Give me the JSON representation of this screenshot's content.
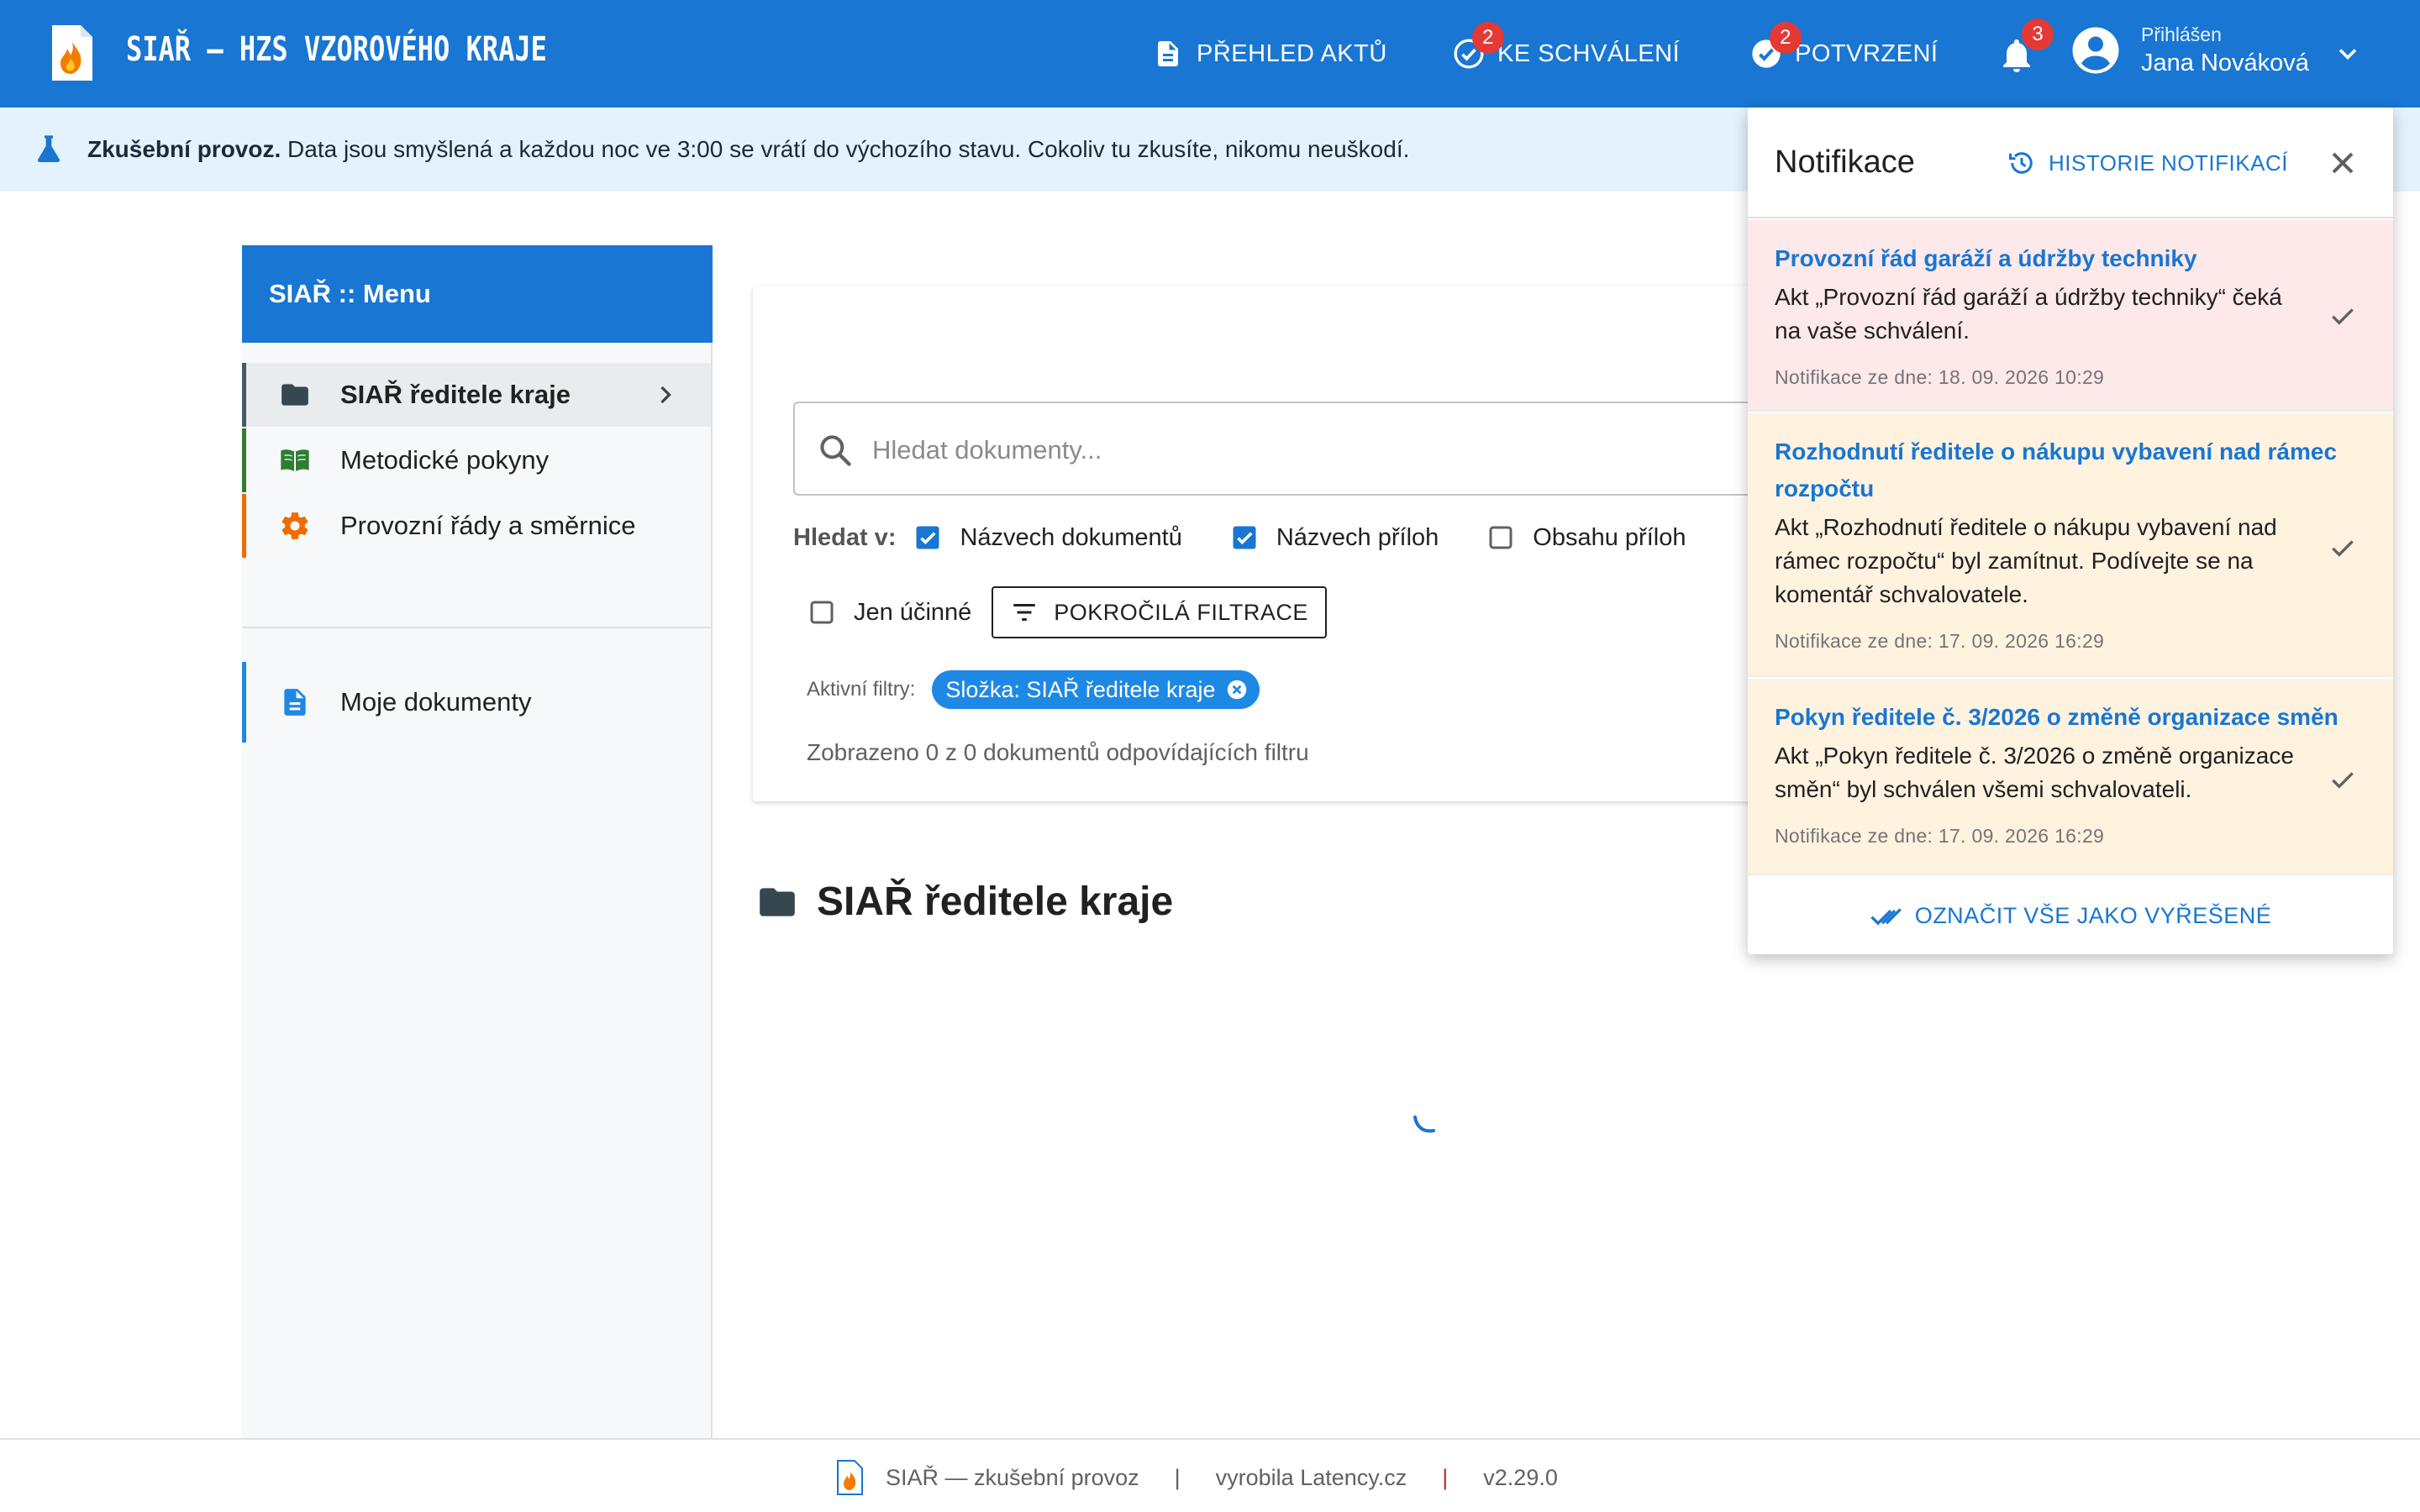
{
  "app": {
    "title": "SIAŘ – HZS VZOROVÉHO KRAJE",
    "brand_color": "#1976d2"
  },
  "nav": {
    "overview": {
      "label": "PŘEHLED AKTŮ"
    },
    "approval": {
      "label": "KE SCHVÁLENÍ",
      "badge": "2"
    },
    "confirm": {
      "label": "POTVRZENÍ",
      "badge": "2"
    },
    "notifications": {
      "badge": "3"
    },
    "user": {
      "label": "Přihlášen",
      "name": "Jana Nováková"
    }
  },
  "banner": {
    "strong": "Zkušební provoz.",
    "text": " Data jsou smyšlená a každou noc ve 3:00 se vrátí do výchozího stavu. Cokoliv tu zkusíte, nikomu neuškodí."
  },
  "sidebar": {
    "header": "SIAŘ :: Menu",
    "items": [
      {
        "label": "SIAŘ ředitele kraje",
        "icon": "folder-icon",
        "accent": "#455a64"
      },
      {
        "label": "Metodické pokyny",
        "icon": "book-icon",
        "accent": "#2e7d32"
      },
      {
        "label": "Provozní řády a směrnice",
        "icon": "gear-icon",
        "accent": "#ef6c00"
      },
      {
        "label": "Moje dokumenty",
        "icon": "document-icon",
        "accent": "#1e88e5"
      }
    ]
  },
  "search": {
    "placeholder": "Hledat dokumenty...",
    "value": "",
    "search_in_label": "Hledat v:",
    "options": [
      {
        "label": "Názvech dokumentů",
        "checked": true
      },
      {
        "label": "Názvech příloh",
        "checked": true
      },
      {
        "label": "Obsahu příloh",
        "checked": false
      }
    ],
    "effective_only": {
      "label": "Jen účinné",
      "checked": false
    },
    "advanced_label": "POKROČILÁ FILTRACE",
    "active_filters_label": "Aktivní filtry:",
    "active_filter_chip": "Složka: SIAŘ ředitele kraje",
    "results_text": "Zobrazeno 0 z 0 dokumentů odpovídajících filtru"
  },
  "section": {
    "title": "SIAŘ ředitele kraje"
  },
  "notifications": {
    "title": "Notifikace",
    "history_label": "HISTORIE NOTIFIKACÍ",
    "mark_all_label": "OZNAČIT VŠE JAKO VYŘEŠENÉ",
    "items": [
      {
        "title": "Provozní řád garáží a údržby techniky",
        "body": "Akt „Provozní řád garáží a údržby techniky“ čeká na vaše schválení.",
        "date": "Notifikace ze dne: 18. 09. 2026 10:29",
        "tone": "#fde8ea"
      },
      {
        "title": "Rozhodnutí ředitele o nákupu vybavení nad rámec rozpočtu",
        "body": "Akt „Rozhodnutí ředitele o nákupu vybavení nad rámec rozpočtu“ byl zamítnut. Podívejte se na komentář schvalovatele.",
        "date": "Notifikace ze dne: 17. 09. 2026 16:29",
        "tone": "#fff3e0"
      },
      {
        "title": "Pokyn ředitele č. 3/2026 o změně organizace směn",
        "body": "Akt „Pokyn ředitele č. 3/2026 o změně organizace směn“ byl schválen všemi schvalovateli.",
        "date": "Notifikace ze dne: 17. 09. 2026 16:29",
        "tone": "#fff3e0"
      }
    ]
  },
  "footer": {
    "name": "SIAŘ — zkušební provoz",
    "maker": "vyrobila Latency.cz",
    "version": "v2.29.0"
  }
}
